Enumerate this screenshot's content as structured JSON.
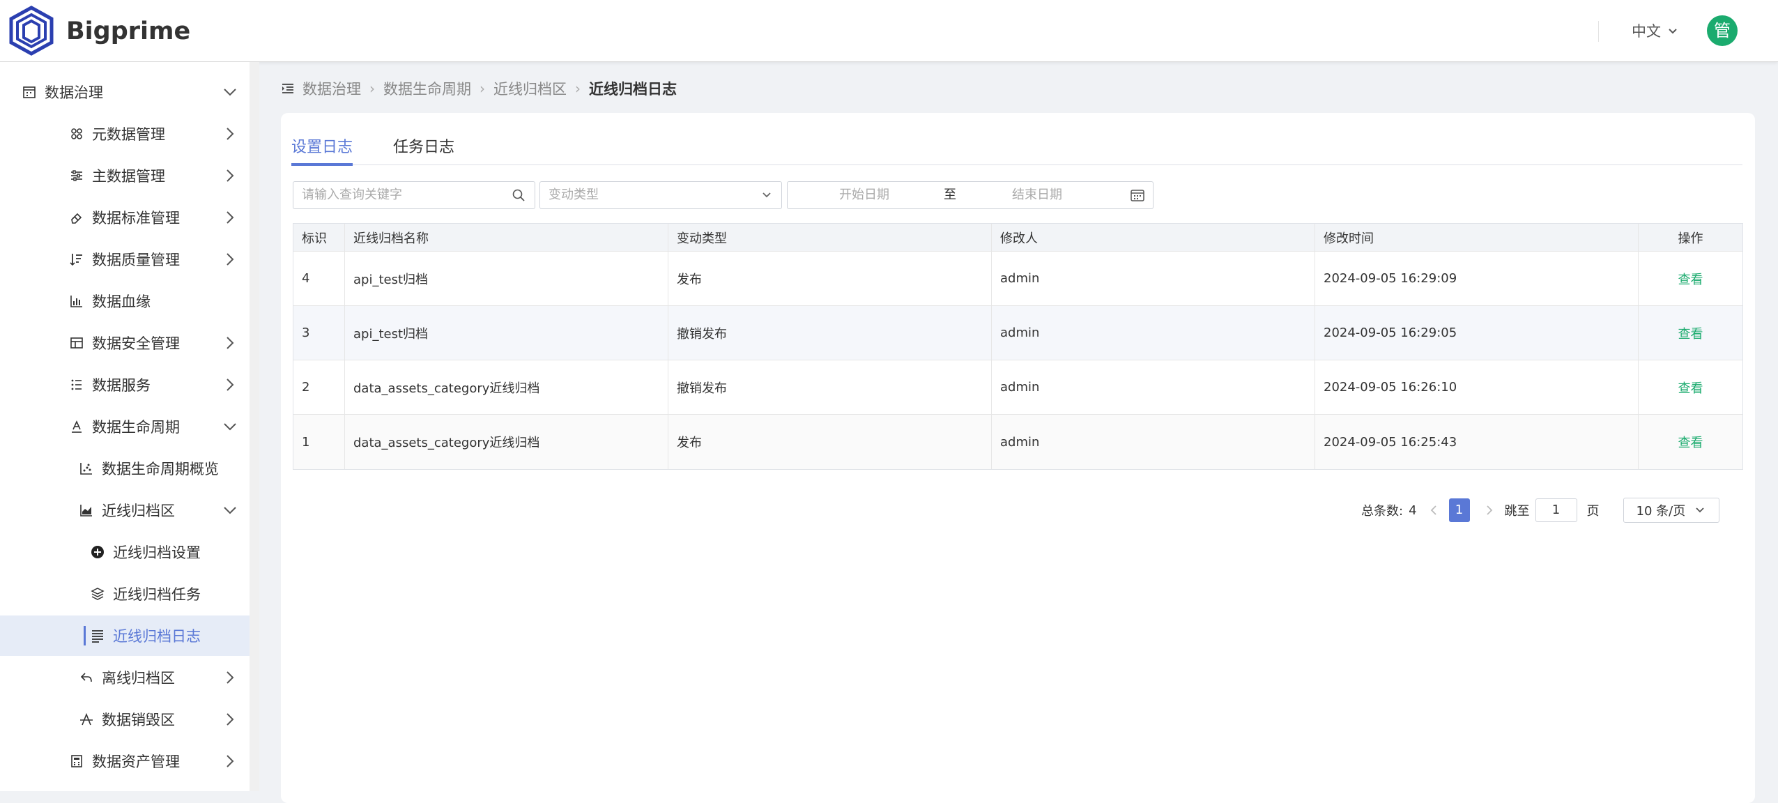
{
  "app": {
    "brand": "Bigprime",
    "language": "中文",
    "avatar_char": "管",
    "accent": "#5a78d6",
    "success": "#1bab6e"
  },
  "sidebar": {
    "items": [
      {
        "label": "数据治理",
        "icon": "calendar-icon",
        "expanded": true
      },
      {
        "label": "元数据管理",
        "icon": "cluster-icon"
      },
      {
        "label": "主数据管理",
        "icon": "sliders-icon"
      },
      {
        "label": "数据标准管理",
        "icon": "eraser-icon"
      },
      {
        "label": "数据质量管理",
        "icon": "sort-icon"
      },
      {
        "label": "数据血缘",
        "icon": "bar-chart-icon"
      },
      {
        "label": "数据安全管理",
        "icon": "table-icon"
      },
      {
        "label": "数据服务",
        "icon": "list-icon"
      },
      {
        "label": "数据生命周期",
        "icon": "text-underline-icon",
        "expanded": true
      },
      {
        "label": "数据生命周期概览",
        "icon": "scatter-chart-icon"
      },
      {
        "label": "近线归档区",
        "icon": "area-chart-icon",
        "expanded": true
      },
      {
        "label": "近线归档设置",
        "icon": "plus-circle-icon"
      },
      {
        "label": "近线归档任务",
        "icon": "layers-icon"
      },
      {
        "label": "近线归档日志",
        "icon": "log-lines-icon",
        "active": true
      },
      {
        "label": "离线归档区",
        "icon": "reply-icon"
      },
      {
        "label": "数据销毁区",
        "icon": "strikethrough-icon"
      },
      {
        "label": "数据资产管理",
        "icon": "calculator-icon"
      }
    ]
  },
  "breadcrumb": {
    "items": [
      "数据治理",
      "数据生命周期",
      "近线归档区"
    ],
    "current": "近线归档日志"
  },
  "tabs": [
    {
      "label": "设置日志",
      "active": true
    },
    {
      "label": "任务日志"
    }
  ],
  "filters": {
    "search_placeholder": "请输入查询关键字",
    "type_placeholder": "变动类型",
    "start_placeholder": "开始日期",
    "range_sep": "至",
    "end_placeholder": "结束日期"
  },
  "table": {
    "columns": [
      "标识",
      "近线归档名称",
      "变动类型",
      "修改人",
      "修改时间",
      "操作"
    ],
    "rows": [
      {
        "id": "4",
        "name": "api_test归档",
        "type": "发布",
        "user": "admin",
        "time": "2024-09-05 16:29:09",
        "action": "查看"
      },
      {
        "id": "3",
        "name": "api_test归档",
        "type": "撤销发布",
        "user": "admin",
        "time": "2024-09-05 16:29:05",
        "action": "查看"
      },
      {
        "id": "2",
        "name": "data_assets_category近线归档",
        "type": "撤销发布",
        "user": "admin",
        "time": "2024-09-05 16:26:10",
        "action": "查看"
      },
      {
        "id": "1",
        "name": "data_assets_category近线归档",
        "type": "发布",
        "user": "admin",
        "time": "2024-09-05 16:25:43",
        "action": "查看"
      }
    ]
  },
  "pagination": {
    "total_label": "总条数:",
    "total": "4",
    "current_page": "1",
    "jump_label": "跳至",
    "jump_value": "1",
    "page_unit": "页",
    "page_size": "10 条/页"
  }
}
